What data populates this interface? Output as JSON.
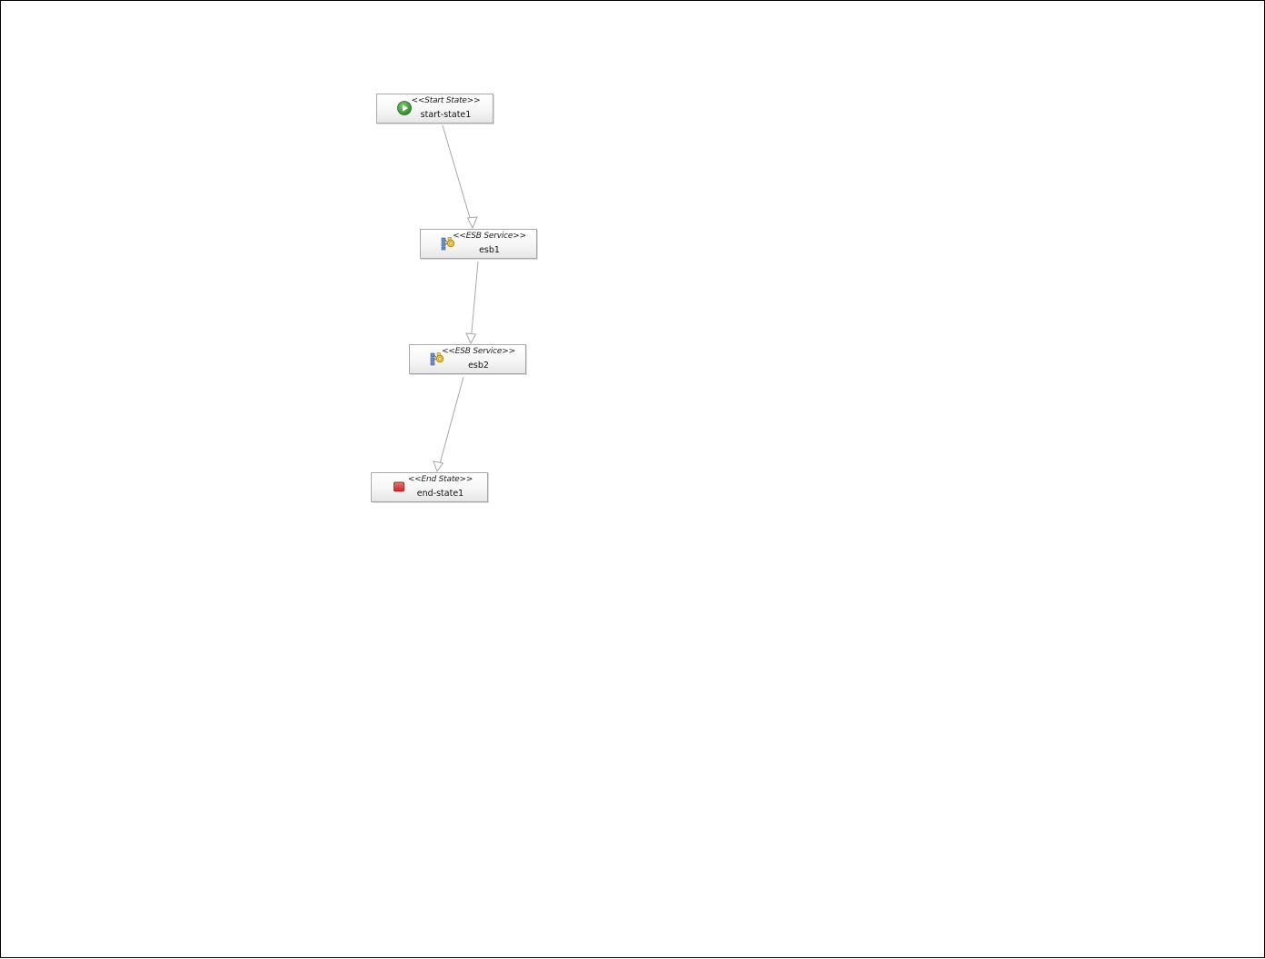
{
  "diagram": {
    "nodes": [
      {
        "id": "start-state1",
        "stereotype": "<<Start State>>",
        "name": "start-state1",
        "icon": "start-play-icon"
      },
      {
        "id": "esb1",
        "stereotype": "<<ESB Service>>",
        "name": "esb1",
        "icon": "esb-service-icon"
      },
      {
        "id": "esb2",
        "stereotype": "<<ESB Service>>",
        "name": "esb2",
        "icon": "esb-service-icon"
      },
      {
        "id": "end-state1",
        "stereotype": "<<End State>>",
        "name": "end-state1",
        "icon": "end-stop-icon"
      }
    ],
    "transitions": [
      {
        "from": "start-state1",
        "to": "esb1"
      },
      {
        "from": "esb1",
        "to": "esb2"
      },
      {
        "from": "esb2",
        "to": "end-state1"
      }
    ],
    "colors": {
      "start_icon": "#3f9a3f",
      "end_icon": "#d94040",
      "edge": "#a8a8a8",
      "node_border": "#a9a9a9"
    }
  }
}
